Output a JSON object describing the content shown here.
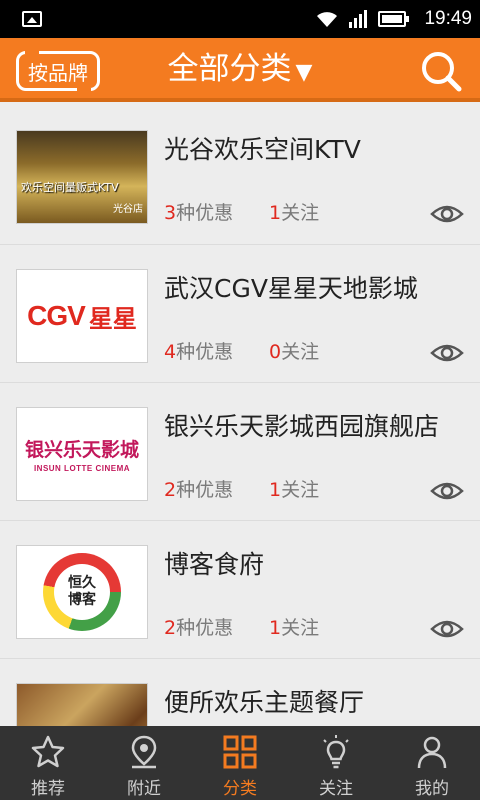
{
  "status": {
    "time": "19:49"
  },
  "header": {
    "brand_button": "按品牌",
    "title": "全部分类",
    "title_caret": "▼"
  },
  "items": [
    {
      "title": "光谷欢乐空间KTV",
      "offers_count": "3",
      "offers_label": "种优惠",
      "follow_count": "1",
      "follow_label": "关注",
      "thumb_text": "欢乐空间量贩式KTV",
      "thumb_sub": "光谷店"
    },
    {
      "title": "武汉CGV星星天地影城",
      "offers_count": "4",
      "offers_label": "种优惠",
      "follow_count": "0",
      "follow_label": "关注",
      "thumb_logo": "CGV",
      "thumb_logo_cn": "星星"
    },
    {
      "title": "银兴乐天影城西园旗舰店",
      "offers_count": "2",
      "offers_label": "种优惠",
      "follow_count": "1",
      "follow_label": "关注",
      "thumb_cn": "银兴乐天影城",
      "thumb_en": "INSUN LOTTE CINEMA"
    },
    {
      "title": "博客食府",
      "offers_count": "2",
      "offers_label": "种优惠",
      "follow_count": "1",
      "follow_label": "关注",
      "thumb_line1": "恒久",
      "thumb_line2": "博客"
    },
    {
      "title": "便所欢乐主题餐厅"
    }
  ],
  "nav": [
    {
      "label": "推荐",
      "icon": "star-icon"
    },
    {
      "label": "附近",
      "icon": "location-pin-icon"
    },
    {
      "label": "分类",
      "icon": "grid-icon",
      "active": true
    },
    {
      "label": "关注",
      "icon": "lightbulb-icon"
    },
    {
      "label": "我的",
      "icon": "person-icon"
    }
  ],
  "colors": {
    "accent": "#f47b20",
    "highlight": "#e0291f",
    "nav_bg": "#333333"
  }
}
